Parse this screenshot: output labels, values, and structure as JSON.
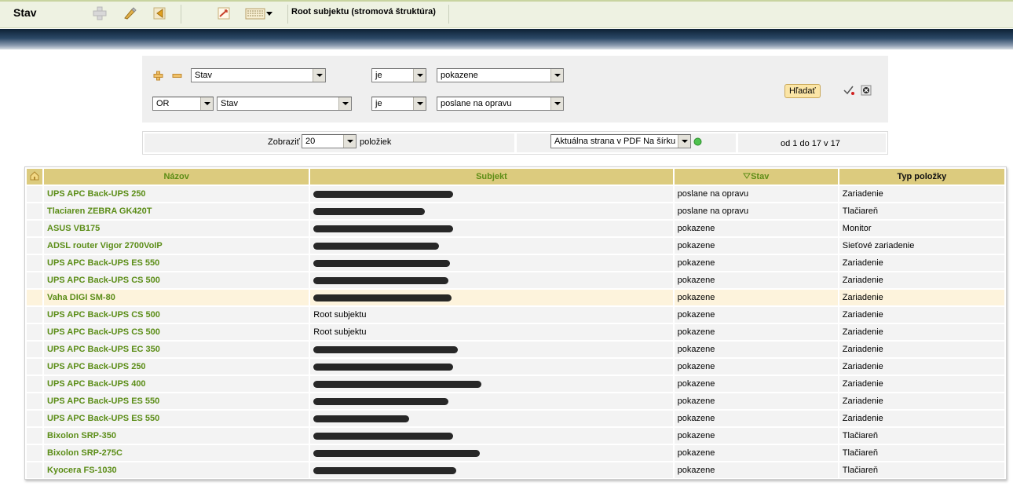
{
  "header": {
    "title": "Stav",
    "subject": "Root subjektu (stromová štruktúra)"
  },
  "filter": {
    "rows": [
      {
        "field": "Stav",
        "operator": "je",
        "value": "pokazene"
      },
      {
        "logic": "OR",
        "field": "Stav",
        "operator": "je",
        "value": "poslane na opravu"
      }
    ],
    "search_label": "Hľadať"
  },
  "pager": {
    "show_label": "Zobraziť",
    "page_size": "20",
    "items_label": "položiek",
    "export_option": "Aktuálna strana v PDF Na šírku",
    "range_text": "od 1 do 17 v 17"
  },
  "table": {
    "headers": {
      "name": "Názov",
      "subject": "Subjekt",
      "state": "Stav",
      "type": "Typ položky"
    },
    "rows": [
      {
        "name": "UPS APC Back-UPS 250",
        "subject": "",
        "state": "poslane na opravu",
        "type": "Zariadenie"
      },
      {
        "name": "Tlaciaren ZEBRA GK420T",
        "subject": "",
        "state": "poslane na opravu",
        "type": "Tlačiareň"
      },
      {
        "name": "ASUS VB175",
        "subject": "",
        "state": "pokazene",
        "type": "Monitor"
      },
      {
        "name": "ADSL router Vigor 2700VoIP",
        "subject": "",
        "state": "pokazene",
        "type": "Sieťové zariadenie"
      },
      {
        "name": "UPS APC Back-UPS ES 550",
        "subject": "",
        "state": "pokazene",
        "type": "Zariadenie"
      },
      {
        "name": "UPS APC Back-UPS CS 500",
        "subject": "",
        "state": "pokazene",
        "type": "Zariadenie"
      },
      {
        "name": "Vaha DIGI SM-80",
        "subject": "",
        "state": "pokazene",
        "type": "Zariadenie"
      },
      {
        "name": "UPS APC Back-UPS CS 500",
        "subject": "Root subjektu",
        "state": "pokazene",
        "type": "Zariadenie"
      },
      {
        "name": "UPS APC Back-UPS CS 500",
        "subject": "Root subjektu",
        "state": "pokazene",
        "type": "Zariadenie"
      },
      {
        "name": "UPS APC Back-UPS EC 350",
        "subject": "",
        "state": "pokazene",
        "type": "Zariadenie"
      },
      {
        "name": "UPS APC Back-UPS 250",
        "subject": "",
        "state": "pokazene",
        "type": "Zariadenie"
      },
      {
        "name": "UPS APC Back-UPS 400",
        "subject": "",
        "state": "pokazene",
        "type": "Zariadenie"
      },
      {
        "name": "UPS APC Back-UPS ES 550",
        "subject": "",
        "state": "pokazene",
        "type": "Zariadenie"
      },
      {
        "name": "UPS APC Back-UPS ES 550",
        "subject": "",
        "state": "pokazene",
        "type": "Zariadenie"
      },
      {
        "name": "Bixolon SRP-350",
        "subject": "",
        "state": "pokazene",
        "type": "Tlačiareň"
      },
      {
        "name": "Bixolon SRP-275C",
        "subject": "",
        "state": "pokazene",
        "type": "Tlačiareň"
      },
      {
        "name": "Kyocera FS-1030",
        "subject": "",
        "state": "pokazene",
        "type": "Tlačiareň"
      }
    ]
  },
  "colors": {
    "accent_green": "#5b8d17",
    "header_bg": "#dccb7e",
    "highlight_row": "#fdf3dc"
  }
}
